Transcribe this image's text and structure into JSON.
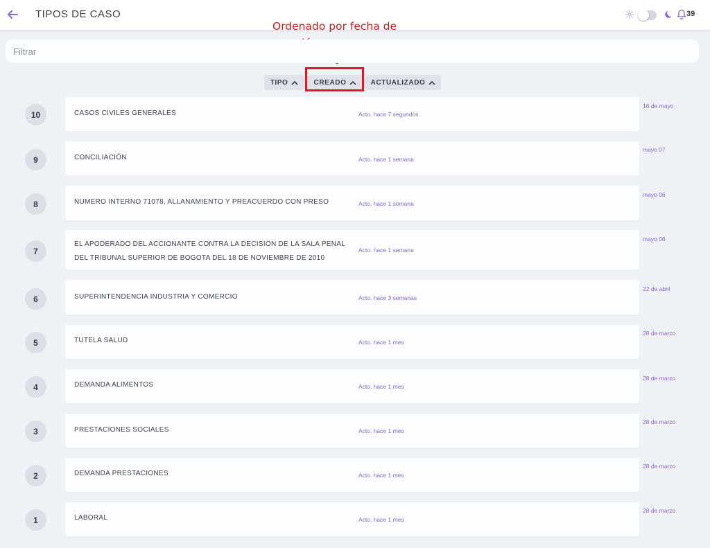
{
  "header": {
    "title": "TIPOS DE CASO",
    "notification_count": "39",
    "icons": [
      "back-arrow-icon",
      "sun-icon",
      "moon-icon",
      "bell-icon"
    ]
  },
  "annotation": {
    "line1": "Ordenado por fecha de",
    "line2": "creación",
    "color": "#d21a1a"
  },
  "filter": {
    "placeholder": "Filtrar",
    "value": ""
  },
  "sort": {
    "tipo": "TIPO",
    "creado": "CREADO",
    "actualizado": "ACTUALIZADO",
    "active": "CREADO"
  },
  "colors": {
    "accent": "#8a63d2",
    "highlight": "#e8141c",
    "background": "#eef1f6"
  },
  "rows": [
    {
      "number": "10",
      "title": "CASOS CIVILES GENERALES",
      "updated": "Acto. hace 7 segundos",
      "created": "16 de mayo"
    },
    {
      "number": "9",
      "title": "CONCILIACIÓN",
      "updated": "Acto. hace 1 semana",
      "created": "mayo 07"
    },
    {
      "number": "8",
      "title": "NUMERO INTERNO 71078, ALLANAMIENTO Y PREACUERDO CON PRESO",
      "updated": "Acto. hace 1 semana",
      "created": "mayo 06"
    },
    {
      "number": "7",
      "title": "EL APODERADO DEL ACCIONANTE CONTRA LA DECISION DE LA SALA PENAL DEL TRIBUNAL SUPERIOR DE BOGOTA DEL 18 DE NOVIEMBRE DE 2010",
      "updated": "Acto. hace 1 semana",
      "created": "mayo 06"
    },
    {
      "number": "6",
      "title": "SUPERINTENDENCIA INDUSTRIA Y COMERCIO",
      "updated": "Acto. hace 3 semanas",
      "created": "22 de abril"
    },
    {
      "number": "5",
      "title": "TUTELA SALUD",
      "updated": "Acto. hace 1 mes",
      "created": "28 de marzo"
    },
    {
      "number": "4",
      "title": "DEMANDA ALIMENTOS",
      "updated": "Acto. hace 1 mes",
      "created": "28 de marzo"
    },
    {
      "number": "3",
      "title": "PRESTACIONES SOCIALES",
      "updated": "Acto. hace 1 mes",
      "created": "28 de marzo"
    },
    {
      "number": "2",
      "title": "DEMANDA PRESTACIONES",
      "updated": "Acto. hace 1 mes",
      "created": "28 de marzo"
    },
    {
      "number": "1",
      "title": "LABORAL",
      "updated": "Acto. hace 1 mes",
      "created": "28 de marzo"
    }
  ]
}
